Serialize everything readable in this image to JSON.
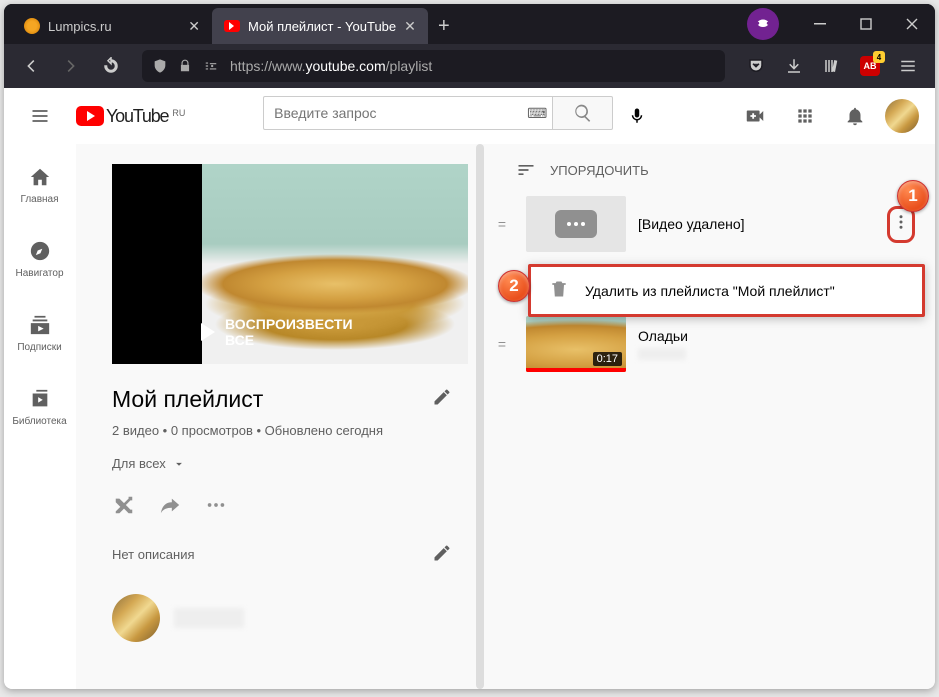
{
  "browser": {
    "tabs": [
      {
        "title": "Lumpics.ru"
      },
      {
        "title": "Мой плейлист - YouTube"
      }
    ],
    "url_prefix": "https://www.",
    "url_domain": "youtube.com",
    "url_path": "/playlist",
    "ext_badge": "4"
  },
  "yt": {
    "logo_text": "YouTube",
    "region": "RU",
    "search_placeholder": "Введите запрос",
    "sidebar": [
      {
        "label": "Главная"
      },
      {
        "label": "Навигатор"
      },
      {
        "label": "Подписки"
      },
      {
        "label": "Библиотека"
      }
    ]
  },
  "playlist": {
    "play_all": "ВОСПРОИЗВЕСТИ ВСЕ",
    "title": "Мой плейлист",
    "meta": "2 видео • 0 просмотров • Обновлено сегодня",
    "privacy": "Для всех",
    "no_desc": "Нет описания",
    "sort": "УПОРЯДОЧИТЬ",
    "videos": [
      {
        "title": "[Видео удалено]"
      },
      {
        "title": "Оладьи",
        "duration": "0:17"
      }
    ],
    "ctx_delete": "Удалить из плейлиста \"Мой плейлист\""
  },
  "callouts": {
    "c1": "1",
    "c2": "2"
  }
}
